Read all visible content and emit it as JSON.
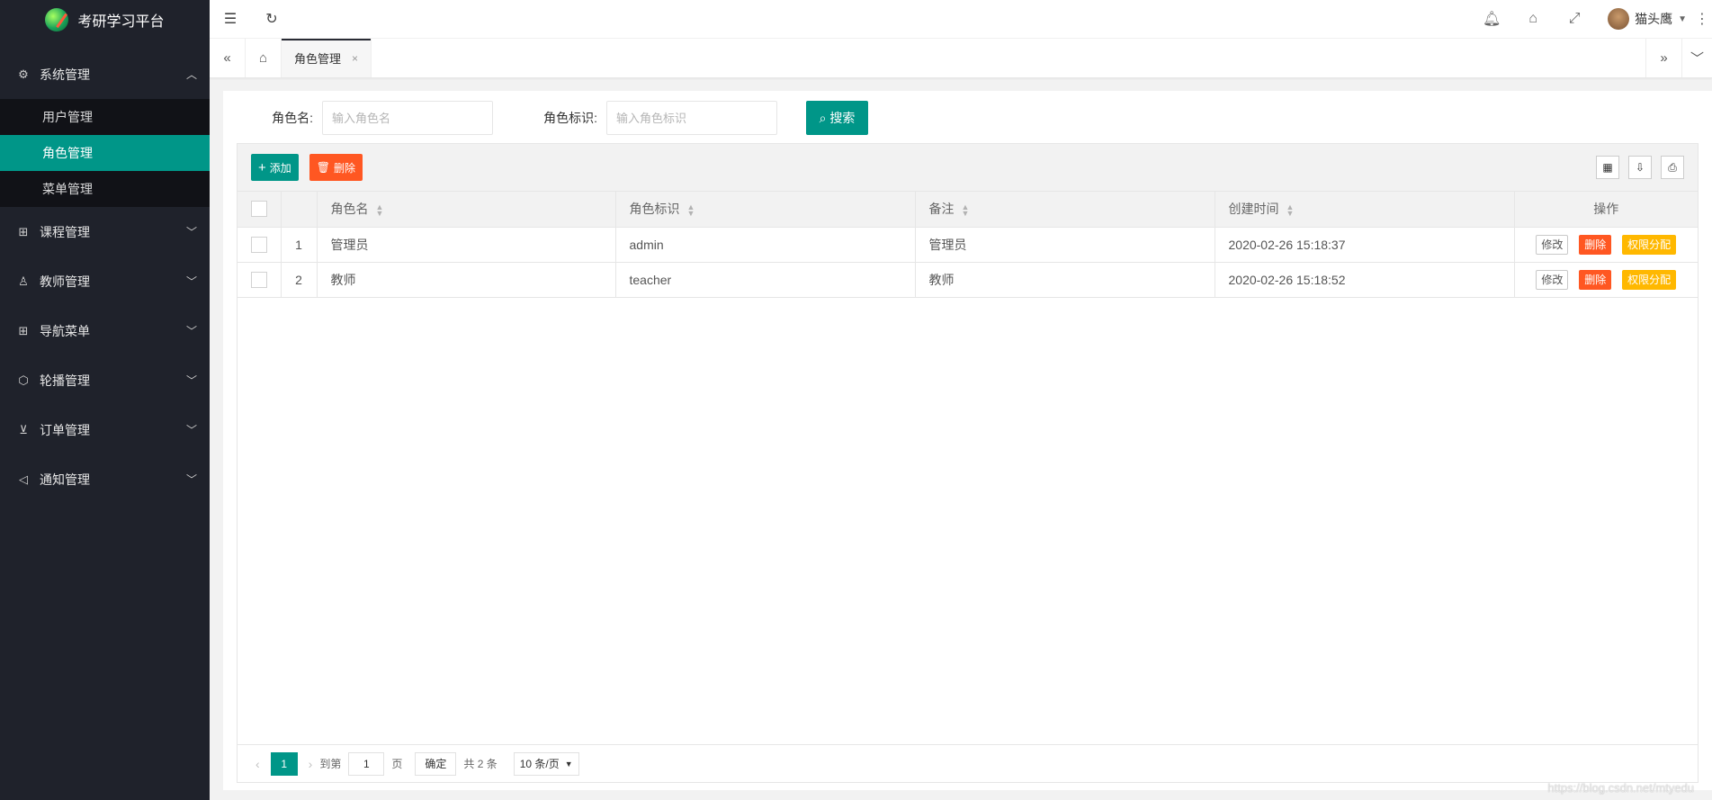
{
  "app": {
    "title": "考研学习平台"
  },
  "sidebar": {
    "groups": [
      {
        "label": "系统管理",
        "icon": "gear-icon",
        "expanded": true,
        "items": [
          {
            "label": "用户管理",
            "active": false
          },
          {
            "label": "角色管理",
            "active": true
          },
          {
            "label": "菜单管理",
            "active": false
          }
        ]
      },
      {
        "label": "课程管理",
        "icon": "apps-icon"
      },
      {
        "label": "教师管理",
        "icon": "user-icon"
      },
      {
        "label": "导航菜单",
        "icon": "apps-icon"
      },
      {
        "label": "轮播管理",
        "icon": "cube-icon"
      },
      {
        "label": "订单管理",
        "icon": "cart-icon"
      },
      {
        "label": "通知管理",
        "icon": "speaker-icon"
      }
    ]
  },
  "header": {
    "user_name": "猫头鹰"
  },
  "tabs": [
    {
      "label": "角色管理",
      "active": true
    }
  ],
  "search": {
    "role_name_label": "角色名:",
    "role_name_placeholder": "输入角色名",
    "role_key_label": "角色标识:",
    "role_key_placeholder": "输入角色标识",
    "button": "搜索"
  },
  "toolbar": {
    "add_label": "添加",
    "delete_label": "删除"
  },
  "table": {
    "columns": [
      "角色名",
      "角色标识",
      "备注",
      "创建时间",
      "操作"
    ],
    "rows": [
      {
        "index": "1",
        "name": "管理员",
        "key": "admin",
        "remark": "管理员",
        "created": "2020-02-26 15:18:37"
      },
      {
        "index": "2",
        "name": "教师",
        "key": "teacher",
        "remark": "教师",
        "created": "2020-02-26 15:18:52"
      }
    ],
    "actions": {
      "edit": "修改",
      "delete": "删除",
      "perm": "权限分配"
    }
  },
  "pager": {
    "current_page": "1",
    "goto_label": "到第",
    "goto_value": "1",
    "page_unit": "页",
    "confirm": "确定",
    "total": "共 2 条",
    "page_size": "10 条/页"
  },
  "watermark": "https://blog.csdn.net/mtyedu",
  "colors": {
    "primary": "#009688",
    "danger": "#ff5722",
    "warn": "#ffb800",
    "sidebar": "#1f222b"
  }
}
